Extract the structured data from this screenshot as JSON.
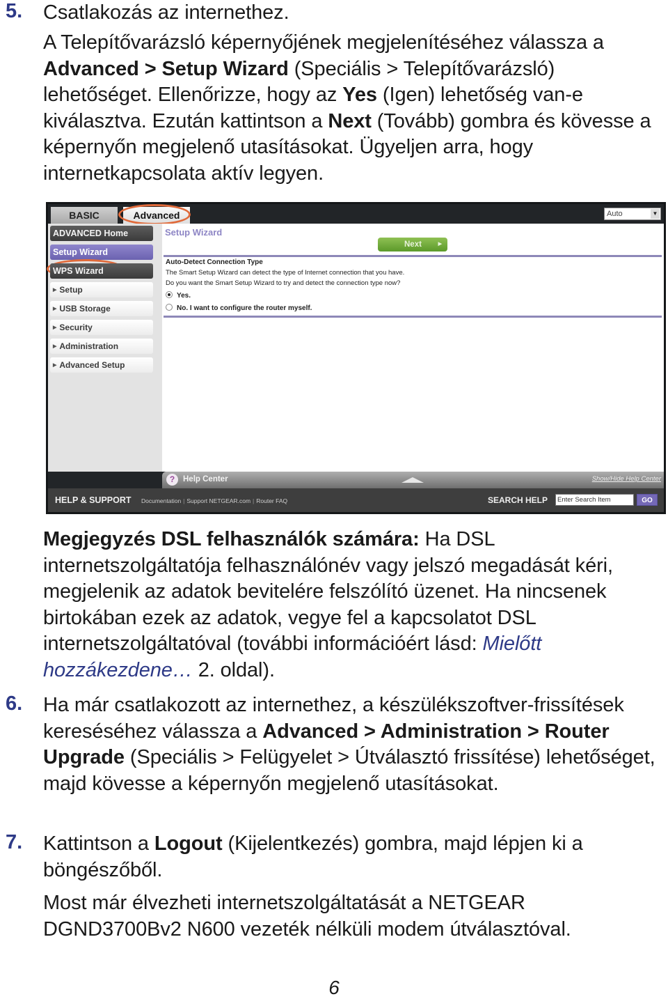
{
  "step5": {
    "number": "5.",
    "heading": "Csatlakozás az internethez.",
    "para": [
      {
        "t": "A Telepítővarázsló képernyőjének megjelenítéséhez válassza a "
      },
      {
        "t": "Advanced > Setup Wizard",
        "b": true
      },
      {
        "t": " (Speciális > Telepítővarázsló) lehetőséget. Ellenőrizze, hogy az "
      },
      {
        "t": "Yes",
        "b": true
      },
      {
        "t": " (Igen) lehetőség van-e kiválasztva. Ezután kattintson a "
      },
      {
        "t": "Next",
        "b": true
      },
      {
        "t": " (Tovább) gombra és kövesse a képernyőn megjelenő utasításokat. Ügyeljen arra, hogy internetkapcsolata aktív legyen."
      }
    ]
  },
  "router_ui": {
    "tabs": {
      "basic": "BASIC",
      "advanced": "Advanced"
    },
    "language_select": "Auto",
    "sidebar": {
      "advanced_home": "ADVANCED Home",
      "setup_wizard": "Setup Wizard",
      "wps_wizard": "WPS Wizard",
      "items": [
        "Setup",
        "USB Storage",
        "Security",
        "Administration",
        "Advanced Setup"
      ]
    },
    "content": {
      "title": "Setup Wizard",
      "next_button": "Next",
      "section_heading": "Auto-Detect Connection Type",
      "line1": "The Smart Setup Wizard can detect the type of Internet connection that you have.",
      "line2": "Do you want the Smart Setup Wizard to try and detect the connection type now?",
      "option_yes": "Yes.",
      "option_no": "No. I want to configure the router myself.",
      "selected": "Yes."
    },
    "help_center": {
      "label": "Help Center",
      "toggle": "Show/Hide Help Center",
      "icon": "?"
    },
    "footer": {
      "title": "HELP & SUPPORT",
      "links": [
        "Documentation",
        "Support NETGEAR.com",
        "Router FAQ"
      ],
      "search_label": "SEARCH HELP",
      "search_value": "Enter Search Item",
      "go_button": "GO"
    },
    "highlight_color": "#e06a3a"
  },
  "note": {
    "bold_prefix": "Megjegyzés DSL felhasználók számára:",
    "text": " Ha DSL internetszolgáltatója felhasználónév vagy jelszó megadását kéri, megjelenik az adatok bevitelére felszólító üzenet. Ha nincsenek birtokában ezek az adatok, vegye fel a kapcsolatot DSL internetszolgáltatóval (további információért lásd: ",
    "link": "Mielőtt hozzákezdene…",
    "suffix": " 2. oldal)."
  },
  "step6": {
    "number": "6.",
    "para": [
      {
        "t": "Ha már csatlakozott az internethez, a készülékszoftver-frissítések kereséséhez válassza a "
      },
      {
        "t": "Advanced > Administration > Router Upgrade",
        "b": true
      },
      {
        "t": " (Speciális > Felügyelet > Útválasztó frissítése) lehetőséget, majd kövesse a képernyőn megjelenő utasításokat."
      }
    ]
  },
  "step7": {
    "number": "7.",
    "para": [
      {
        "t": "Kattintson a "
      },
      {
        "t": "Logout",
        "b": true
      },
      {
        "t": " (Kijelentkezés) gombra, majd lépjen ki a böngészőből."
      }
    ]
  },
  "closing": "Most már élvezheti internetszolgáltatását a NETGEAR DGND3700Bv2 N600 vezeték nélküli modem útválasztóval.",
  "page_number": "6",
  "colors": {
    "step_number": "#2e3a87",
    "link": "#2e3a87",
    "accent_purple": "#7468b6",
    "next_green": "#6aa535"
  }
}
